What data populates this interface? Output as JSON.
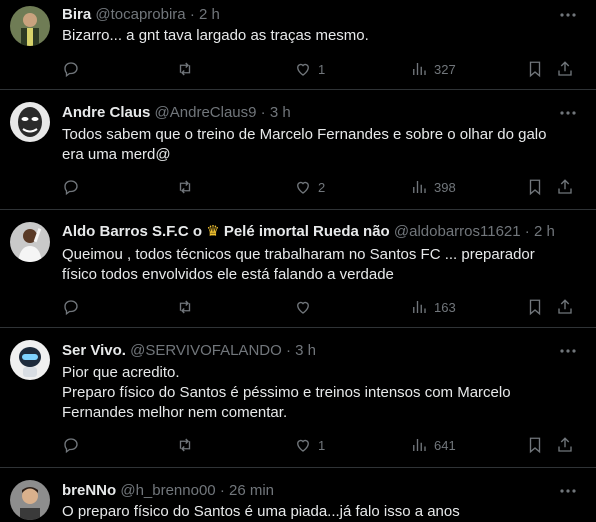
{
  "tweets": [
    {
      "name": "Bira",
      "handle": "@tocaprobira",
      "time": "2 h",
      "lines": [
        "Bizarro... a gnt tava largado as traças mesmo."
      ],
      "replies": "",
      "retweets": "",
      "likes": "1",
      "views": "327",
      "avatar": "man-vest-avatar"
    },
    {
      "name": "Andre Claus",
      "handle": "@AndreClaus9",
      "time": "3 h",
      "lines": [
        "Todos sabem que o treino de Marcelo Fernandes e sobre o olhar do galo",
        "era uma merd@"
      ],
      "replies": "",
      "retweets": "",
      "likes": "2",
      "views": "398",
      "avatar": "mask-avatar"
    },
    {
      "name": "Aldo Barros S.F.C o",
      "name_suffix": "Pelé imortal Rueda não",
      "handle": "@aldobarros11621",
      "time": "2 h",
      "lines": [
        "Queimou , todos  técnicos  que  trabalharam  no Santos FC  ... preparador",
        "físico  todos  envolvidos  ele  está  falando a verdade"
      ],
      "replies": "",
      "retweets": "",
      "likes": "",
      "views": "163",
      "avatar": "player-avatar"
    },
    {
      "name": "Ser Vivo.",
      "handle": "@SERVIVOFALANDO",
      "time": "3 h",
      "lines": [
        "Pior que acredito.",
        "Preparo físico do Santos é péssimo e treinos intensos com Marcelo",
        "Fernandes melhor nem comentar."
      ],
      "replies": "",
      "retweets": "",
      "likes": "1",
      "views": "641",
      "avatar": "robot-avatar"
    },
    {
      "name": "breNNo",
      "handle": "@h_brenno00",
      "time": "26 min",
      "lines": [
        "O preparo físico do Santos é uma piada...já falo isso a anos"
      ],
      "replies": "",
      "retweets": "",
      "likes": "",
      "views": "",
      "avatar": "boy-avatar"
    }
  ],
  "separator": "·"
}
